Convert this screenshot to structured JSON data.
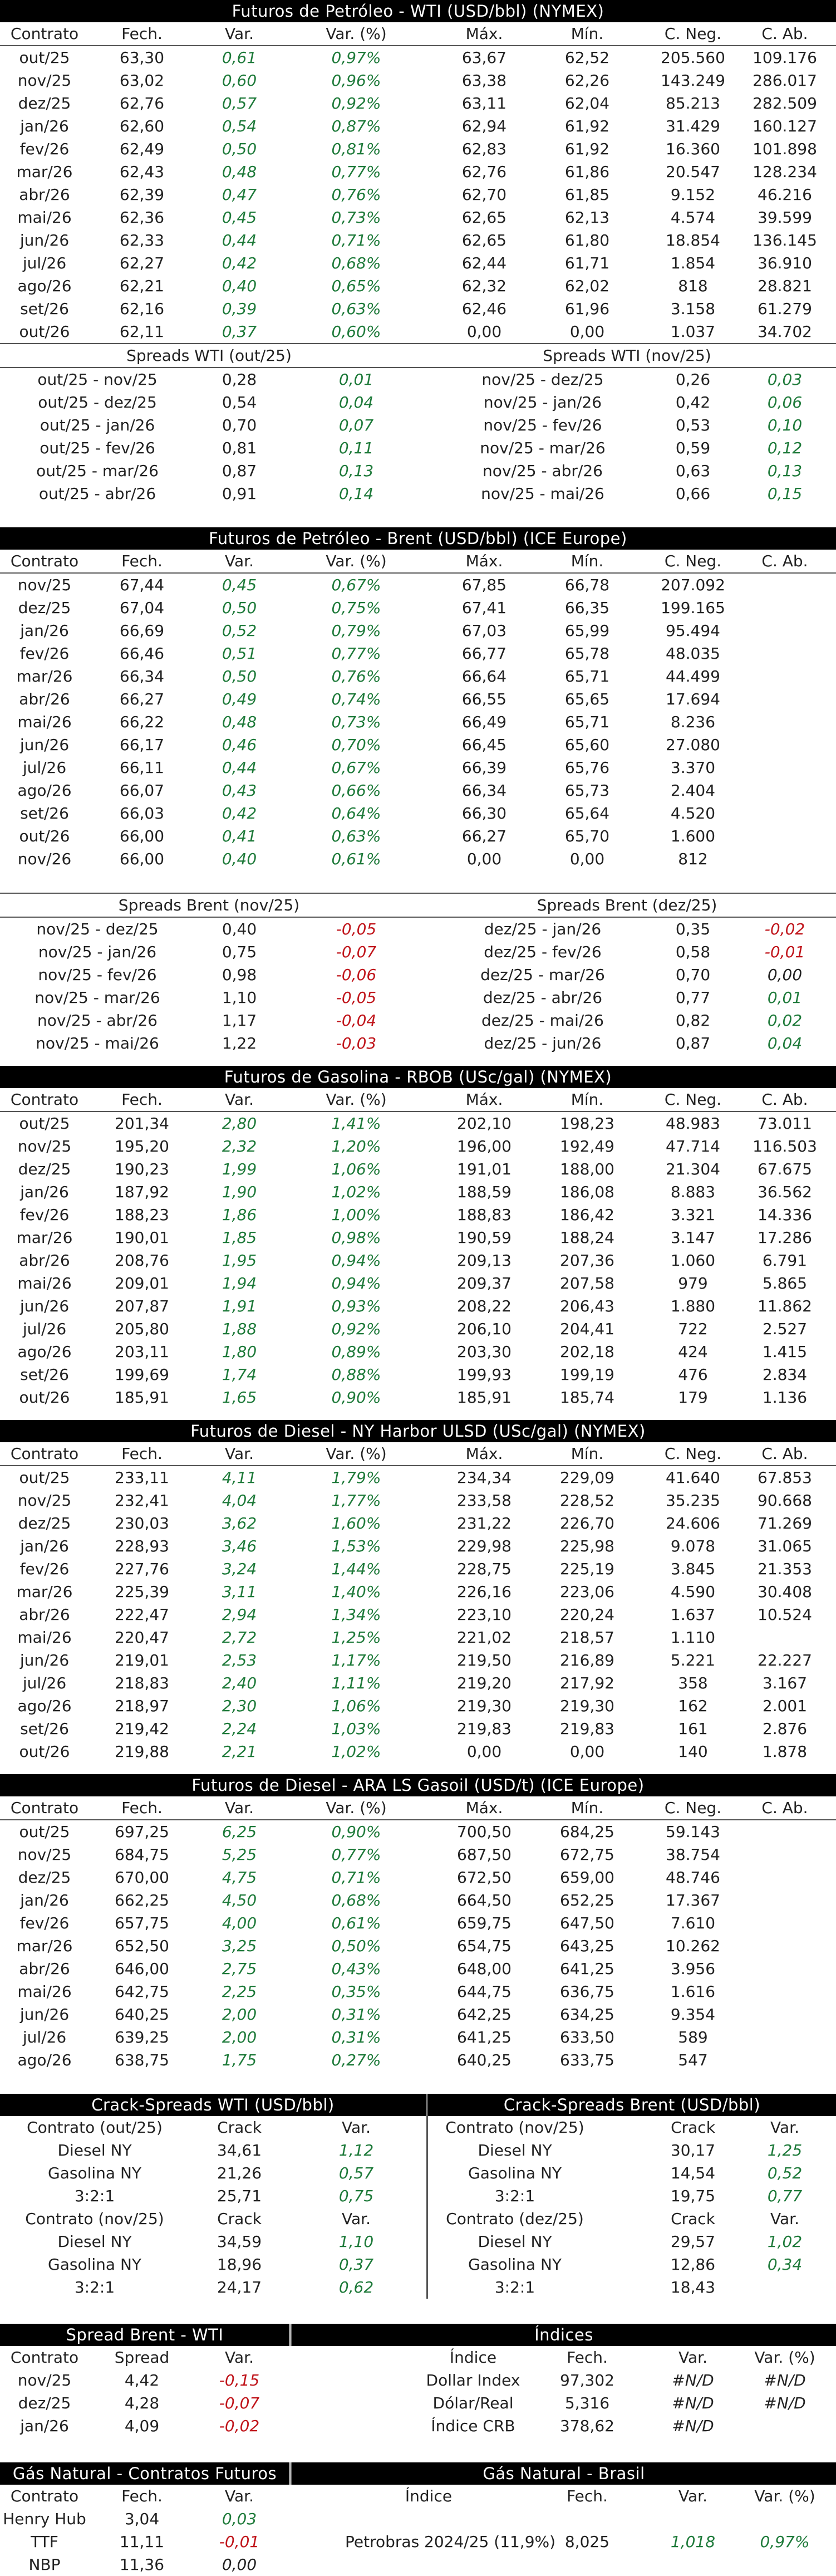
{
  "wti": {
    "title": "Futuros de Petróleo - WTI (USD/bbl) (NYMEX)",
    "headers": [
      "Contrato",
      "Fech.",
      "Var.",
      "Var. (%)",
      "Máx.",
      "Mín.",
      "C. Neg.",
      "C. Ab."
    ],
    "rows": [
      [
        "out/25",
        "63,30",
        "0,61",
        "0,97%",
        "63,67",
        "62,52",
        "205.560",
        "109.176"
      ],
      [
        "nov/25",
        "63,02",
        "0,60",
        "0,96%",
        "63,38",
        "62,26",
        "143.249",
        "286.017"
      ],
      [
        "dez/25",
        "62,76",
        "0,57",
        "0,92%",
        "63,11",
        "62,04",
        "85.213",
        "282.509"
      ],
      [
        "jan/26",
        "62,60",
        "0,54",
        "0,87%",
        "62,94",
        "61,92",
        "31.429",
        "160.127"
      ],
      [
        "fev/26",
        "62,49",
        "0,50",
        "0,81%",
        "62,83",
        "61,92",
        "16.360",
        "101.898"
      ],
      [
        "mar/26",
        "62,43",
        "0,48",
        "0,77%",
        "62,76",
        "61,86",
        "20.547",
        "128.234"
      ],
      [
        "abr/26",
        "62,39",
        "0,47",
        "0,76%",
        "62,70",
        "61,85",
        "9.152",
        "46.216"
      ],
      [
        "mai/26",
        "62,36",
        "0,45",
        "0,73%",
        "62,65",
        "62,13",
        "4.574",
        "39.599"
      ],
      [
        "jun/26",
        "62,33",
        "0,44",
        "0,71%",
        "62,65",
        "61,80",
        "18.854",
        "136.145"
      ],
      [
        "jul/26",
        "62,27",
        "0,42",
        "0,68%",
        "62,44",
        "61,71",
        "1.854",
        "36.910"
      ],
      [
        "ago/26",
        "62,21",
        "0,40",
        "0,65%",
        "62,32",
        "62,02",
        "818",
        "28.821"
      ],
      [
        "set/26",
        "62,16",
        "0,39",
        "0,63%",
        "62,46",
        "61,96",
        "3.158",
        "61.279"
      ],
      [
        "out/26",
        "62,11",
        "0,37",
        "0,60%",
        "0,00",
        "0,00",
        "1.037",
        "34.702"
      ]
    ],
    "spreads_left_title": "Spreads WTI (out/25)",
    "spreads_right_title": "Spreads WTI (nov/25)",
    "spreads_left": [
      [
        "out/25 - nov/25",
        "0,28",
        "0,01"
      ],
      [
        "out/25 - dez/25",
        "0,54",
        "0,04"
      ],
      [
        "out/25 - jan/26",
        "0,70",
        "0,07"
      ],
      [
        "out/25 - fev/26",
        "0,81",
        "0,11"
      ],
      [
        "out/25 - mar/26",
        "0,87",
        "0,13"
      ],
      [
        "out/25 - abr/26",
        "0,91",
        "0,14"
      ]
    ],
    "spreads_right": [
      [
        "nov/25 - dez/25",
        "0,26",
        "0,03"
      ],
      [
        "nov/25 - jan/26",
        "0,42",
        "0,06"
      ],
      [
        "nov/25 - fev/26",
        "0,53",
        "0,10"
      ],
      [
        "nov/25 - mar/26",
        "0,59",
        "0,12"
      ],
      [
        "nov/25 - abr/26",
        "0,63",
        "0,13"
      ],
      [
        "nov/25 - mai/26",
        "0,66",
        "0,15"
      ]
    ]
  },
  "brent": {
    "title": "Futuros de Petróleo - Brent (USD/bbl) (ICE Europe)",
    "headers": [
      "Contrato",
      "Fech.",
      "Var.",
      "Var. (%)",
      "Máx.",
      "Mín.",
      "C. Neg.",
      "C. Ab."
    ],
    "rows": [
      [
        "nov/25",
        "67,44",
        "0,45",
        "0,67%",
        "67,85",
        "66,78",
        "207.092",
        ""
      ],
      [
        "dez/25",
        "67,04",
        "0,50",
        "0,75%",
        "67,41",
        "66,35",
        "199.165",
        ""
      ],
      [
        "jan/26",
        "66,69",
        "0,52",
        "0,79%",
        "67,03",
        "65,99",
        "95.494",
        ""
      ],
      [
        "fev/26",
        "66,46",
        "0,51",
        "0,77%",
        "66,77",
        "65,78",
        "48.035",
        ""
      ],
      [
        "mar/26",
        "66,34",
        "0,50",
        "0,76%",
        "66,64",
        "65,71",
        "44.499",
        ""
      ],
      [
        "abr/26",
        "66,27",
        "0,49",
        "0,74%",
        "66,55",
        "65,65",
        "17.694",
        ""
      ],
      [
        "mai/26",
        "66,22",
        "0,48",
        "0,73%",
        "66,49",
        "65,71",
        "8.236",
        ""
      ],
      [
        "jun/26",
        "66,17",
        "0,46",
        "0,70%",
        "66,45",
        "65,60",
        "27.080",
        ""
      ],
      [
        "jul/26",
        "66,11",
        "0,44",
        "0,67%",
        "66,39",
        "65,76",
        "3.370",
        ""
      ],
      [
        "ago/26",
        "66,07",
        "0,43",
        "0,66%",
        "66,34",
        "65,73",
        "2.404",
        ""
      ],
      [
        "set/26",
        "66,03",
        "0,42",
        "0,64%",
        "66,30",
        "65,64",
        "4.520",
        ""
      ],
      [
        "out/26",
        "66,00",
        "0,41",
        "0,63%",
        "66,27",
        "65,70",
        "1.600",
        ""
      ],
      [
        "nov/26",
        "66,00",
        "0,40",
        "0,61%",
        "0,00",
        "0,00",
        "812",
        ""
      ]
    ],
    "spreads_left_title": "Spreads Brent (nov/25)",
    "spreads_right_title": "Spreads Brent (dez/25)",
    "spreads_left": [
      [
        "nov/25 - dez/25",
        "0,40",
        "-0,05"
      ],
      [
        "nov/25 - jan/26",
        "0,75",
        "-0,07"
      ],
      [
        "nov/25 - fev/26",
        "0,98",
        "-0,06"
      ],
      [
        "nov/25 - mar/26",
        "1,10",
        "-0,05"
      ],
      [
        "nov/25 - abr/26",
        "1,17",
        "-0,04"
      ],
      [
        "nov/25 - mai/26",
        "1,22",
        "-0,03"
      ]
    ],
    "spreads_right": [
      [
        "dez/25 - jan/26",
        "0,35",
        "-0,02"
      ],
      [
        "dez/25 - fev/26",
        "0,58",
        "-0,01"
      ],
      [
        "dez/25 - mar/26",
        "0,70",
        "0,00"
      ],
      [
        "dez/25 - abr/26",
        "0,77",
        "0,01"
      ],
      [
        "dez/25 - mai/26",
        "0,82",
        "0,02"
      ],
      [
        "dez/25 - jun/26",
        "0,87",
        "0,04"
      ]
    ]
  },
  "rbob": {
    "title": "Futuros de Gasolina - RBOB (USc/gal) (NYMEX)",
    "headers": [
      "Contrato",
      "Fech.",
      "Var.",
      "Var. (%)",
      "Máx.",
      "Mín.",
      "C. Neg.",
      "C. Ab."
    ],
    "rows": [
      [
        "out/25",
        "201,34",
        "2,80",
        "1,41%",
        "202,10",
        "198,23",
        "48.983",
        "73.011"
      ],
      [
        "nov/25",
        "195,20",
        "2,32",
        "1,20%",
        "196,00",
        "192,49",
        "47.714",
        "116.503"
      ],
      [
        "dez/25",
        "190,23",
        "1,99",
        "1,06%",
        "191,01",
        "188,00",
        "21.304",
        "67.675"
      ],
      [
        "jan/26",
        "187,92",
        "1,90",
        "1,02%",
        "188,59",
        "186,08",
        "8.883",
        "36.562"
      ],
      [
        "fev/26",
        "188,23",
        "1,86",
        "1,00%",
        "188,83",
        "186,42",
        "3.321",
        "14.336"
      ],
      [
        "mar/26",
        "190,01",
        "1,85",
        "0,98%",
        "190,59",
        "188,24",
        "3.147",
        "17.286"
      ],
      [
        "abr/26",
        "208,76",
        "1,95",
        "0,94%",
        "209,13",
        "207,36",
        "1.060",
        "6.791"
      ],
      [
        "mai/26",
        "209,01",
        "1,94",
        "0,94%",
        "209,37",
        "207,58",
        "979",
        "5.865"
      ],
      [
        "jun/26",
        "207,87",
        "1,91",
        "0,93%",
        "208,22",
        "206,43",
        "1.880",
        "11.862"
      ],
      [
        "jul/26",
        "205,80",
        "1,88",
        "0,92%",
        "206,10",
        "204,41",
        "722",
        "2.527"
      ],
      [
        "ago/26",
        "203,11",
        "1,80",
        "0,89%",
        "203,30",
        "202,18",
        "424",
        "1.415"
      ],
      [
        "set/26",
        "199,69",
        "1,74",
        "0,88%",
        "199,93",
        "199,19",
        "476",
        "2.834"
      ],
      [
        "out/26",
        "185,91",
        "1,65",
        "0,90%",
        "185,91",
        "185,74",
        "179",
        "1.136"
      ]
    ]
  },
  "ulsd": {
    "title": "Futuros de Diesel - NY Harbor ULSD (USc/gal) (NYMEX)",
    "headers": [
      "Contrato",
      "Fech.",
      "Var.",
      "Var. (%)",
      "Máx.",
      "Mín.",
      "C. Neg.",
      "C. Ab."
    ],
    "rows": [
      [
        "out/25",
        "233,11",
        "4,11",
        "1,79%",
        "234,34",
        "229,09",
        "41.640",
        "67.853"
      ],
      [
        "nov/25",
        "232,41",
        "4,04",
        "1,77%",
        "233,58",
        "228,52",
        "35.235",
        "90.668"
      ],
      [
        "dez/25",
        "230,03",
        "3,62",
        "1,60%",
        "231,22",
        "226,70",
        "24.606",
        "71.269"
      ],
      [
        "jan/26",
        "228,93",
        "3,46",
        "1,53%",
        "229,98",
        "225,98",
        "9.078",
        "31.065"
      ],
      [
        "fev/26",
        "227,76",
        "3,24",
        "1,44%",
        "228,75",
        "225,19",
        "3.845",
        "21.353"
      ],
      [
        "mar/26",
        "225,39",
        "3,11",
        "1,40%",
        "226,16",
        "223,06",
        "4.590",
        "30.408"
      ],
      [
        "abr/26",
        "222,47",
        "2,94",
        "1,34%",
        "223,10",
        "220,24",
        "1.637",
        "10.524"
      ],
      [
        "mai/26",
        "220,47",
        "2,72",
        "1,25%",
        "221,02",
        "218,57",
        "1.110",
        ""
      ],
      [
        "jun/26",
        "219,01",
        "2,53",
        "1,17%",
        "219,50",
        "216,89",
        "5.221",
        "22.227"
      ],
      [
        "jul/26",
        "218,83",
        "2,40",
        "1,11%",
        "219,20",
        "217,92",
        "358",
        "3.167"
      ],
      [
        "ago/26",
        "218,97",
        "2,30",
        "1,06%",
        "219,30",
        "219,30",
        "162",
        "2.001"
      ],
      [
        "set/26",
        "219,42",
        "2,24",
        "1,03%",
        "219,83",
        "219,83",
        "161",
        "2.876"
      ],
      [
        "out/26",
        "219,88",
        "2,21",
        "1,02%",
        "0,00",
        "0,00",
        "140",
        "1.878"
      ]
    ]
  },
  "gasoil": {
    "title": "Futuros de Diesel - ARA LS Gasoil (USD/t) (ICE Europe)",
    "headers": [
      "Contrato",
      "Fech.",
      "Var.",
      "Var. (%)",
      "Máx.",
      "Mín.",
      "C. Neg.",
      "C. Ab."
    ],
    "rows": [
      [
        "out/25",
        "697,25",
        "6,25",
        "0,90%",
        "700,50",
        "684,25",
        "59.143",
        ""
      ],
      [
        "nov/25",
        "684,75",
        "5,25",
        "0,77%",
        "687,50",
        "672,75",
        "38.754",
        ""
      ],
      [
        "dez/25",
        "670,00",
        "4,75",
        "0,71%",
        "672,50",
        "659,00",
        "48.746",
        ""
      ],
      [
        "jan/26",
        "662,25",
        "4,50",
        "0,68%",
        "664,50",
        "652,25",
        "17.367",
        ""
      ],
      [
        "fev/26",
        "657,75",
        "4,00",
        "0,61%",
        "659,75",
        "647,50",
        "7.610",
        ""
      ],
      [
        "mar/26",
        "652,50",
        "3,25",
        "0,50%",
        "654,75",
        "643,25",
        "10.262",
        ""
      ],
      [
        "abr/26",
        "646,00",
        "2,75",
        "0,43%",
        "648,00",
        "641,25",
        "3.956",
        ""
      ],
      [
        "mai/26",
        "642,75",
        "2,25",
        "0,35%",
        "644,75",
        "636,75",
        "1.616",
        ""
      ],
      [
        "jun/26",
        "640,25",
        "2,00",
        "0,31%",
        "642,25",
        "634,25",
        "9.354",
        ""
      ],
      [
        "jul/26",
        "639,25",
        "2,00",
        "0,31%",
        "641,25",
        "633,50",
        "589",
        ""
      ],
      [
        "ago/26",
        "638,75",
        "1,75",
        "0,27%",
        "640,25",
        "633,75",
        "547",
        ""
      ]
    ]
  },
  "crack": {
    "wti_title": "Crack-Spreads WTI (USD/bbl)",
    "brent_title": "Crack-Spreads Brent (USD/bbl)",
    "wti_blocks": [
      {
        "headers": [
          "Contrato (out/25)",
          "Crack",
          "Var."
        ],
        "rows": [
          [
            "Diesel NY",
            "34,61",
            "1,12"
          ],
          [
            "Gasolina NY",
            "21,26",
            "0,57"
          ],
          [
            "3:2:1",
            "25,71",
            "0,75"
          ]
        ]
      },
      {
        "headers": [
          "Contrato (nov/25)",
          "Crack",
          "Var."
        ],
        "rows": [
          [
            "Diesel NY",
            "34,59",
            "1,10"
          ],
          [
            "Gasolina NY",
            "18,96",
            "0,37"
          ],
          [
            "3:2:1",
            "24,17",
            "0,62"
          ]
        ]
      }
    ],
    "brent_blocks": [
      {
        "headers": [
          "Contrato (nov/25)",
          "Crack",
          "Var."
        ],
        "rows": [
          [
            "Diesel NY",
            "30,17",
            "1,25"
          ],
          [
            "Gasolina NY",
            "14,54",
            "0,52"
          ],
          [
            "3:2:1",
            "19,75",
            "0,77"
          ]
        ]
      },
      {
        "headers": [
          "Contrato (dez/25)",
          "Crack",
          "Var."
        ],
        "rows": [
          [
            "Diesel NY",
            "29,57",
            "1,02"
          ],
          [
            "Gasolina NY",
            "12,86",
            "0,34"
          ],
          [
            "3:2:1",
            "18,43",
            ""
          ]
        ]
      }
    ]
  },
  "spread_brent_wti": {
    "title": "Spread Brent - WTI",
    "headers": [
      "Contrato",
      "Spread",
      "Var."
    ],
    "rows": [
      [
        "nov/25",
        "4,42",
        "-0,15"
      ],
      [
        "dez/25",
        "4,28",
        "-0,07"
      ],
      [
        "jan/26",
        "4,09",
        "-0,02"
      ]
    ]
  },
  "indices": {
    "title": "Índices",
    "headers": [
      "Índice",
      "Fech.",
      "Var.",
      "Var. (%)"
    ],
    "rows": [
      [
        "Dollar Index",
        "97,302",
        "#N/D",
        "#N/D"
      ],
      [
        "Dólar/Real",
        "5,316",
        "#N/D",
        "#N/D"
      ],
      [
        "Índice CRB",
        "378,62",
        "#N/D",
        ""
      ]
    ]
  },
  "gas_futuros": {
    "title": "Gás Natural - Contratos Futuros",
    "headers": [
      "Contrato",
      "Fech.",
      "Var."
    ],
    "rows": [
      [
        "Henry Hub",
        "3,04",
        "0,03"
      ],
      [
        "TTF",
        "11,11",
        "-0,01"
      ],
      [
        "NBP",
        "11,36",
        "0,00"
      ]
    ]
  },
  "gas_brasil": {
    "title": "Gás Natural - Brasil",
    "headers": [
      "Índice",
      "Fech.",
      "Var.",
      "Var. (%)"
    ],
    "rows": [
      [
        "",
        "",
        "",
        ""
      ],
      [
        "Petrobras 2024/25 (11,9%)",
        "8,025",
        "1,018",
        "0,97%"
      ],
      [
        "",
        "",
        "",
        ""
      ]
    ]
  },
  "colors": {
    "positive": "#1e7a3a",
    "negative": "#c0151b",
    "title_bg": "#000000",
    "title_fg": "#ffffff"
  }
}
